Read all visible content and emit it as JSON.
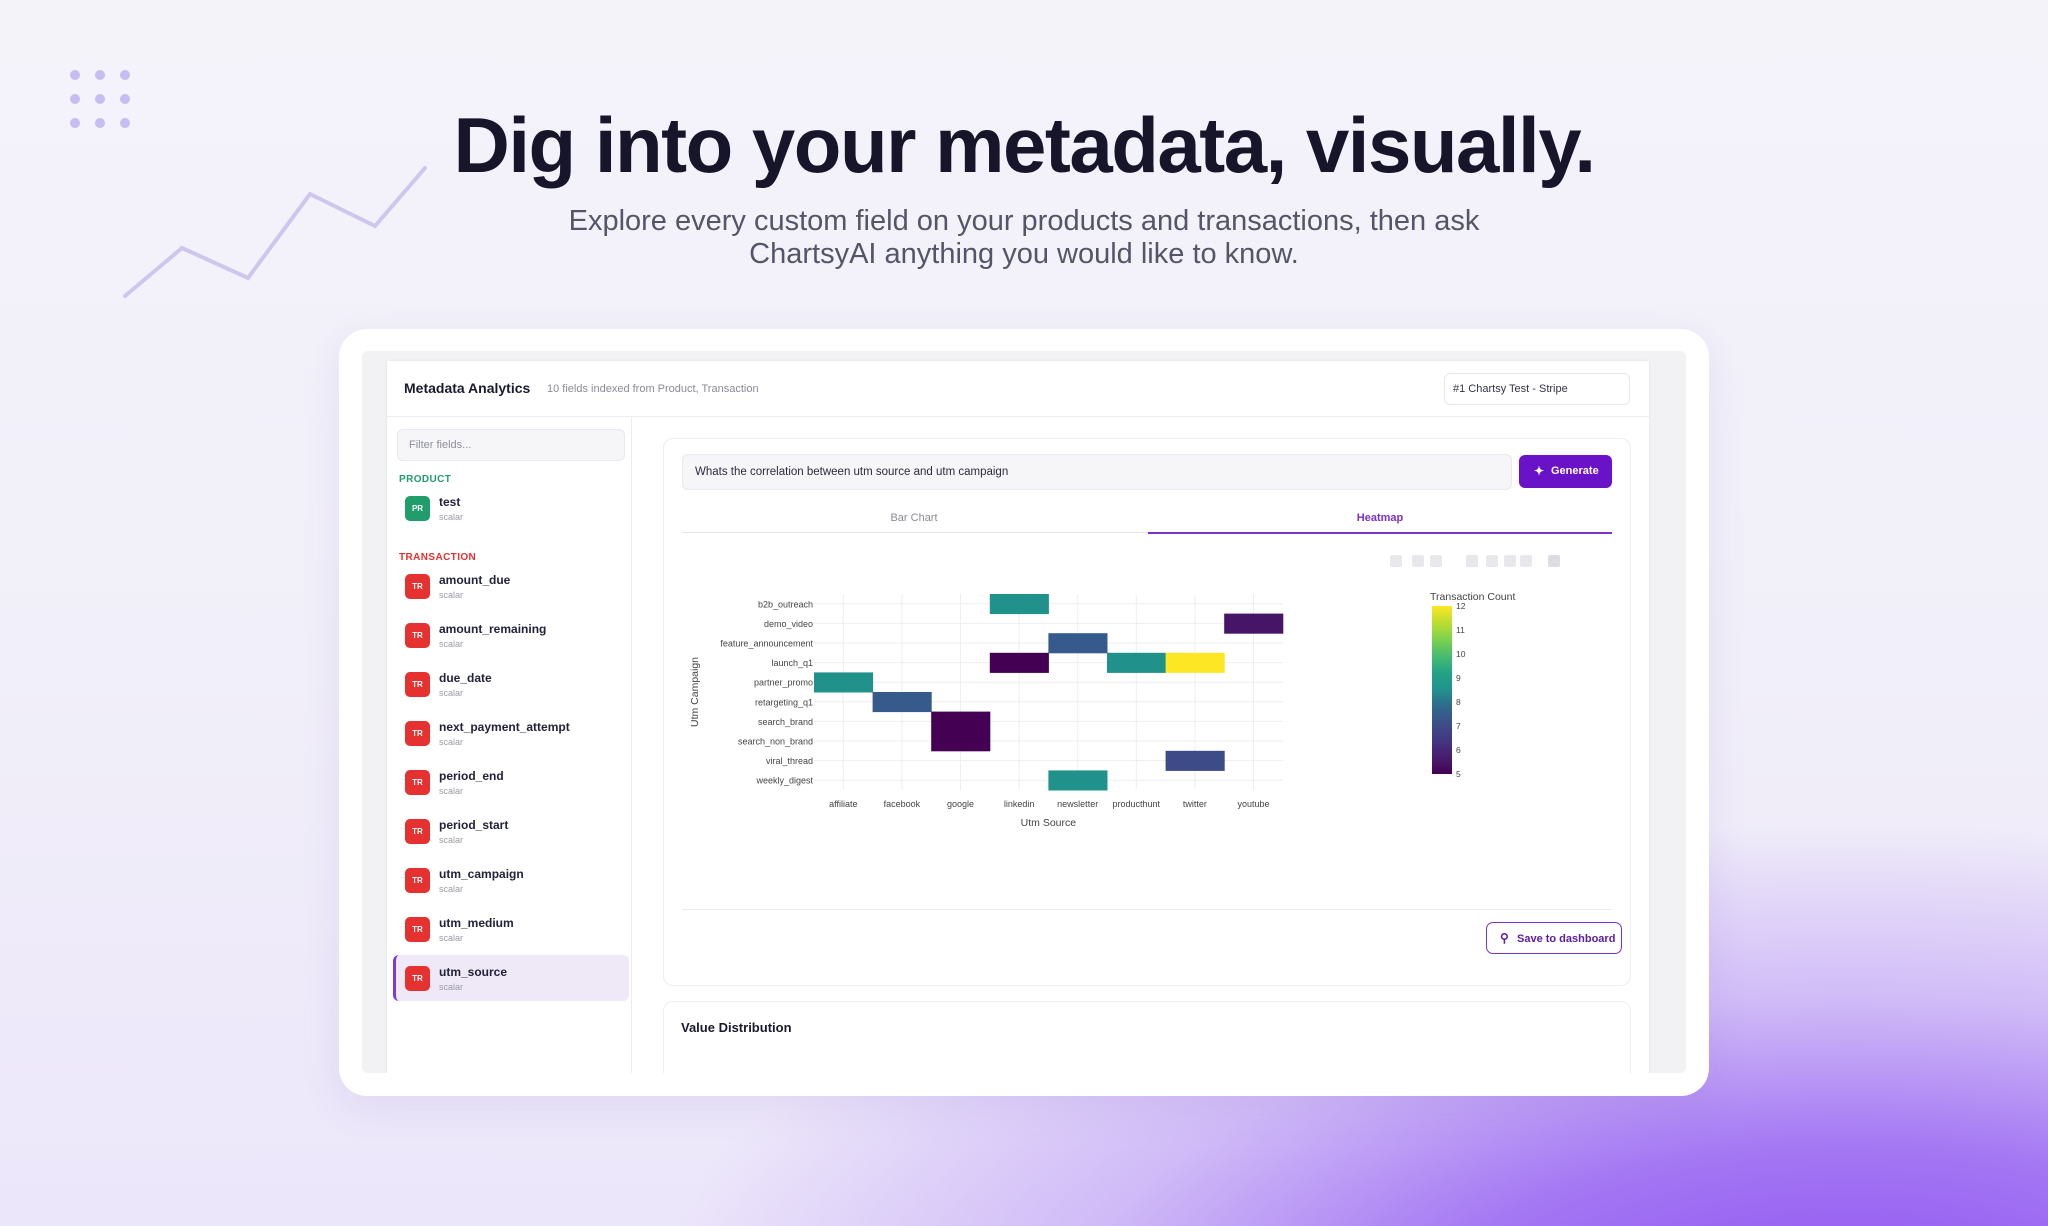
{
  "hero": {
    "title": "Dig into your metadata, visually.",
    "subtitle_line1": "Explore every custom field on your products and transactions, then ask",
    "subtitle_line2": "ChartsyAI anything you would like to know."
  },
  "app": {
    "title": "Metadata Analytics",
    "subtitle": "10 fields indexed from Product, Transaction",
    "datasource": "#1 Chartsy Test - Stripe"
  },
  "sidebar": {
    "filter_placeholder": "Filter fields...",
    "groups": [
      {
        "label": "PRODUCT",
        "color": "#1f9d6b"
      },
      {
        "label": "TRANSACTION",
        "color": "#e5312f"
      }
    ],
    "fields": [
      {
        "badge": "PR",
        "name": "test",
        "type": "scalar"
      },
      {
        "badge": "TR",
        "name": "amount_due",
        "type": "scalar"
      },
      {
        "badge": "TR",
        "name": "amount_remaining",
        "type": "scalar"
      },
      {
        "badge": "TR",
        "name": "due_date",
        "type": "scalar"
      },
      {
        "badge": "TR",
        "name": "next_payment_attempt",
        "type": "scalar"
      },
      {
        "badge": "TR",
        "name": "period_end",
        "type": "scalar"
      },
      {
        "badge": "TR",
        "name": "period_start",
        "type": "scalar"
      },
      {
        "badge": "TR",
        "name": "utm_campaign",
        "type": "scalar"
      },
      {
        "badge": "TR",
        "name": "utm_medium",
        "type": "scalar"
      },
      {
        "badge": "TR",
        "name": "utm_source",
        "type": "scalar",
        "selected": true
      }
    ]
  },
  "query": {
    "text": "Whats the correlation between utm source and utm campaign",
    "generate_label": "Generate"
  },
  "tabs": [
    {
      "label": "Bar Chart",
      "active": false
    },
    {
      "label": "Heatmap",
      "active": true
    }
  ],
  "save_label": "Save to dashboard",
  "value_distribution_title": "Value Distribution",
  "chart_data": {
    "type": "heatmap",
    "x": [
      "affiliate",
      "facebook",
      "google",
      "linkedin",
      "newsletter",
      "producthunt",
      "twitter",
      "youtube"
    ],
    "y": [
      "b2b_outreach",
      "demo_video",
      "feature_announcement",
      "launch_q1",
      "partner_promo",
      "retargeting_q1",
      "search_brand",
      "search_non_brand",
      "viral_thread",
      "weekly_digest"
    ],
    "cells": [
      {
        "x": "linkedin",
        "y": "b2b_outreach",
        "value": 8.5
      },
      {
        "x": "youtube",
        "y": "demo_video",
        "value": 5.5
      },
      {
        "x": "newsletter",
        "y": "feature_announcement",
        "value": 7.5
      },
      {
        "x": "linkedin",
        "y": "launch_q1",
        "value": 5
      },
      {
        "x": "producthunt",
        "y": "launch_q1",
        "value": 8.5
      },
      {
        "x": "twitter",
        "y": "launch_q1",
        "value": 12
      },
      {
        "x": "affiliate",
        "y": "partner_promo",
        "value": 8.5
      },
      {
        "x": "facebook",
        "y": "retargeting_q1",
        "value": 7.5
      },
      {
        "x": "google",
        "y": "search_brand",
        "value": 5
      },
      {
        "x": "google",
        "y": "search_non_brand",
        "value": 5
      },
      {
        "x": "twitter",
        "y": "viral_thread",
        "value": 7
      },
      {
        "x": "newsletter",
        "y": "weekly_digest",
        "value": 8.5
      }
    ],
    "xlabel": "Utm Source",
    "ylabel": "Utm Campaign",
    "colorbar_title": "Transaction Count",
    "colorbar_ticks": [
      5,
      6,
      7,
      8,
      9,
      10,
      11,
      12
    ],
    "zlim": [
      5,
      12
    ],
    "colorscale": "viridis"
  },
  "colors": {
    "accent": "#6a12c8",
    "product_badge": "#1f9d6b",
    "transaction_badge": "#e5312f",
    "active_tab": "#7a32c8"
  },
  "icons": {
    "generate": "sparkle-icon",
    "save": "pin-icon"
  }
}
